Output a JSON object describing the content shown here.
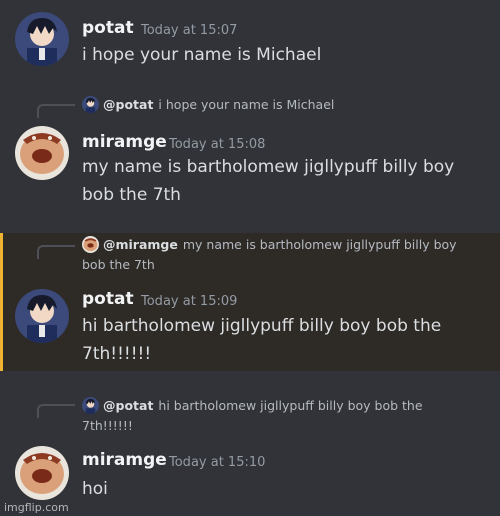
{
  "messages": [
    {
      "author": "potat",
      "timestamp": "Today at 15:07",
      "lines": [
        "i hope your name is Michael"
      ]
    },
    {
      "reply": {
        "author": "@potat",
        "text": "i hope your name is Michael"
      },
      "author": "miramge",
      "timestamp": "Today at 15:08",
      "lines": [
        "my name is bartholomew jigllypuff billy boy",
        "bob the 7th"
      ]
    },
    {
      "reply": {
        "author": "@miramge",
        "text": "my name is bartholomew jigllypuff billy boy",
        "text2": "bob the 7th"
      },
      "author": "potat",
      "timestamp": "Today at 15:09",
      "lines": [
        "hi bartholomew jigllypuff billy boy bob the",
        "7th!!!!!!"
      ]
    },
    {
      "reply": {
        "author": "@potat",
        "text": "hi bartholomew jigllypuff billy boy bob the",
        "text2": "7th!!!!!!"
      },
      "author": "miramge",
      "timestamp": "Today at 15:10",
      "lines": [
        "hoi"
      ]
    }
  ],
  "watermark": "imgflip.com",
  "colors": {
    "background": "#313338",
    "highlight_bar": "#f0b232",
    "author": "#f2f3f5",
    "timestamp": "#949ba4"
  }
}
